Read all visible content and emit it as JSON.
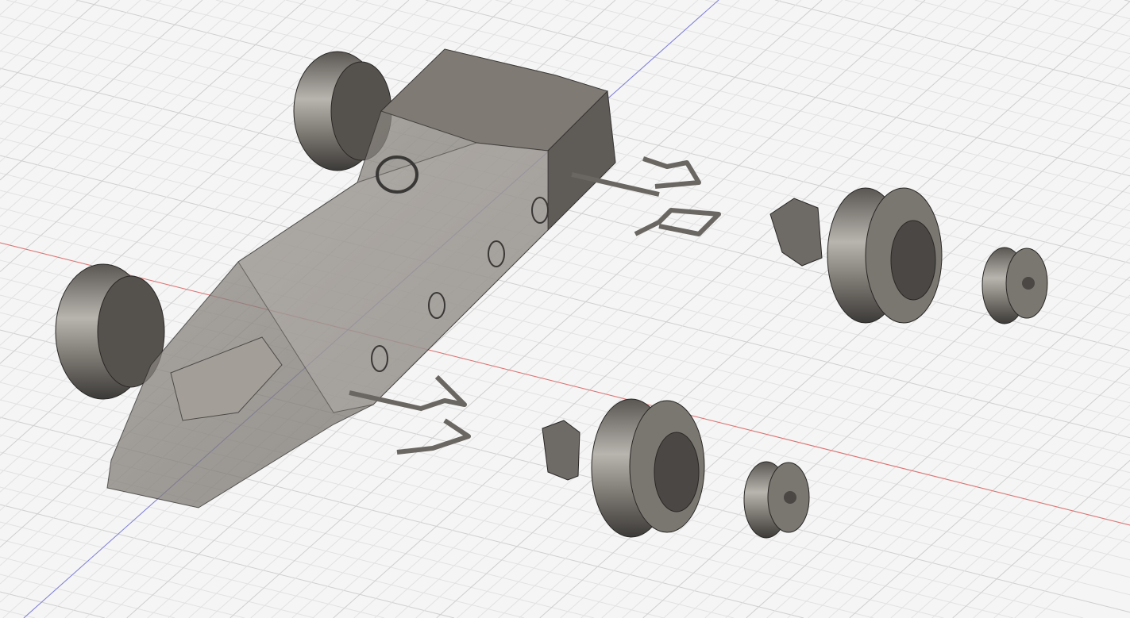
{
  "viewport": {
    "background": "#f5f5f5",
    "grid_minor": "#e2e2e2",
    "grid_major": "#cfcfcf",
    "axis_x_color": "#e07070",
    "axis_z_color": "#8080e0"
  },
  "model": {
    "body_color": "#8a8580",
    "body_dark": "#4a4744",
    "tire_color": "#6e6a66",
    "tire_dark": "#3a3836",
    "glass_color": "#b0aca8"
  }
}
